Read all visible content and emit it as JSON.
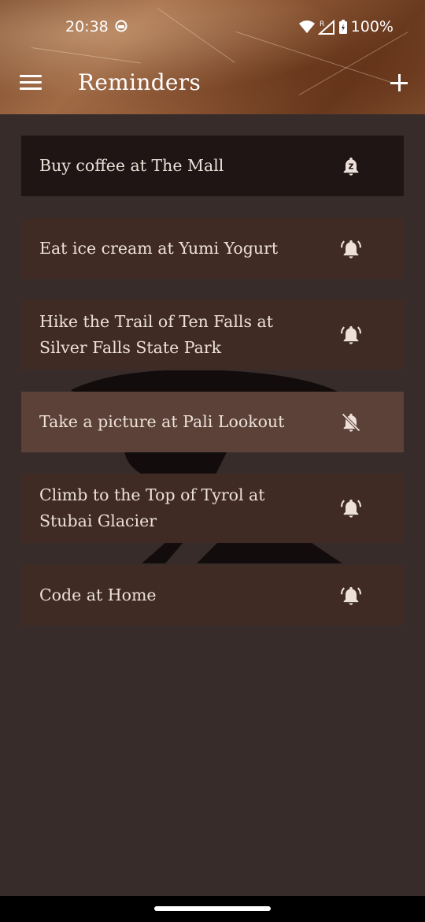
{
  "status": {
    "time": "20:38",
    "battery": "100%",
    "network_label": "R"
  },
  "header": {
    "title": "Reminders"
  },
  "reminders": [
    {
      "text": "Buy coffee at The Mall",
      "bell": "snooze-bell-icon",
      "style": "dark"
    },
    {
      "text": "Eat ice cream at Yumi Yogurt",
      "bell": "ringing-bell-icon",
      "style": "normal"
    },
    {
      "text": "Hike the Trail of Ten Falls at Silver Falls State Park",
      "bell": "ringing-bell-icon",
      "style": "normal"
    },
    {
      "text": "Take a picture at Pali Lookout",
      "bell": "bell-off-icon",
      "style": "light"
    },
    {
      "text": "Climb to the Top of Tyrol at Stubai Glacier",
      "bell": "ringing-bell-icon",
      "style": "normal"
    },
    {
      "text": "Code at Home",
      "bell": "ringing-bell-icon",
      "style": "normal"
    }
  ],
  "colors": {
    "background": "#372c2a",
    "item": "#3f2b24",
    "item_selected_dark": "#1e1514",
    "item_highlight": "#5b4138",
    "text": "#ece0d8"
  }
}
